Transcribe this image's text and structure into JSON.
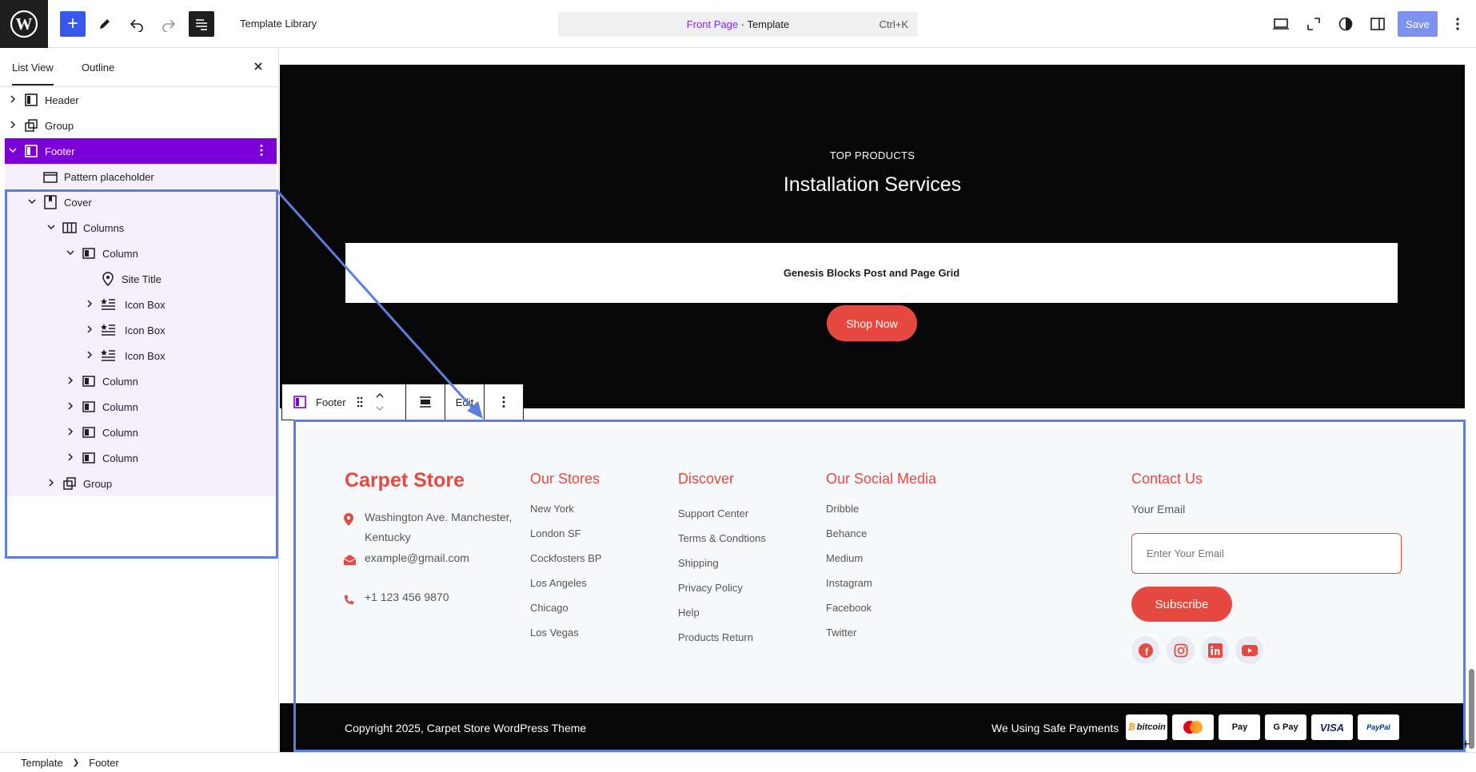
{
  "topbar": {
    "document_title": "Template Library",
    "command_bar": {
      "link": "Front Page",
      "separator": " · ",
      "suffix": "Template",
      "shortcut": "Ctrl+K"
    },
    "save_label": "Save"
  },
  "sidebar": {
    "tabs": [
      "List View",
      "Outline"
    ],
    "tree": [
      {
        "label": "Header",
        "icon": "template-part-icon",
        "expander": "closed"
      },
      {
        "label": "Group",
        "icon": "group-icon",
        "expander": "closed"
      },
      {
        "label": "Footer",
        "icon": "template-part-icon",
        "expander": "open",
        "selected": true
      },
      {
        "label": "Pattern placeholder",
        "icon": "pattern-icon",
        "expander": "none"
      },
      {
        "label": "Cover",
        "icon": "cover-icon",
        "expander": "open"
      },
      {
        "label": "Columns",
        "icon": "columns-icon",
        "expander": "open"
      },
      {
        "label": "Column",
        "icon": "column-icon",
        "expander": "open"
      },
      {
        "label": "Site Title",
        "icon": "map-pin-icon",
        "expander": "none"
      },
      {
        "label": "Icon Box",
        "icon": "icon-box-icon",
        "expander": "closed"
      },
      {
        "label": "Icon Box",
        "icon": "icon-box-icon",
        "expander": "closed"
      },
      {
        "label": "Icon Box",
        "icon": "icon-box-icon",
        "expander": "closed"
      },
      {
        "label": "Column",
        "icon": "column-icon",
        "expander": "closed"
      },
      {
        "label": "Column",
        "icon": "column-icon",
        "expander": "closed"
      },
      {
        "label": "Column",
        "icon": "column-icon",
        "expander": "closed"
      },
      {
        "label": "Column",
        "icon": "column-icon",
        "expander": "closed"
      },
      {
        "label": "Group",
        "icon": "group-icon",
        "expander": "closed"
      }
    ]
  },
  "canvas": {
    "eyebrow": "TOP PRODUCTS",
    "section_title": "Installation Services",
    "grid_label": "Genesis Blocks Post and Page Grid",
    "shop_button": "Shop Now",
    "block_toolbar": {
      "block_name": "Footer",
      "edit_label": "Edit"
    },
    "footer": {
      "brand": "Carpet Store",
      "address": "Washington Ave. Manchester, Kentucky",
      "email": "example@gmail.com",
      "phone": "+1 123 456 9870",
      "stores": {
        "title": "Our Stores",
        "items": [
          "New York",
          "London SF",
          "Cockfosters BP",
          "Los Angeles",
          "Chicago",
          "Los Vegas"
        ]
      },
      "discover": {
        "title": "Discover",
        "items": [
          "Support Center",
          "Terms & Condtions",
          "Shipping",
          "Privacy Policy",
          "Help",
          "Products Return"
        ]
      },
      "social": {
        "title": "Our Social Media",
        "items": [
          "Dribble",
          "Behance",
          "Medium",
          "Instagram",
          "Facebook",
          "Twitter"
        ]
      },
      "contact": {
        "title": "Contact Us",
        "email_label": "Your Email",
        "email_placeholder": "Enter Your Email",
        "subscribe": "Subscribe"
      },
      "social_icons": [
        "facebook-icon",
        "instagram-icon",
        "linkedin-icon",
        "youtube-icon"
      ],
      "copyright": "Copyright 2025, Carpet Store WordPress Theme",
      "payments_label": "We Using Safe Payments",
      "payment_cards": [
        "bitcoin",
        "",
        "Pay",
        "G Pay",
        "VISA",
        "PayPal"
      ]
    }
  },
  "breadcrumb": [
    "Template",
    "Footer"
  ],
  "colors": {
    "accent": "#e5493f",
    "wp_blue": "#3858e9",
    "selection": "#7b00d8",
    "frame": "#5b7ee0"
  }
}
